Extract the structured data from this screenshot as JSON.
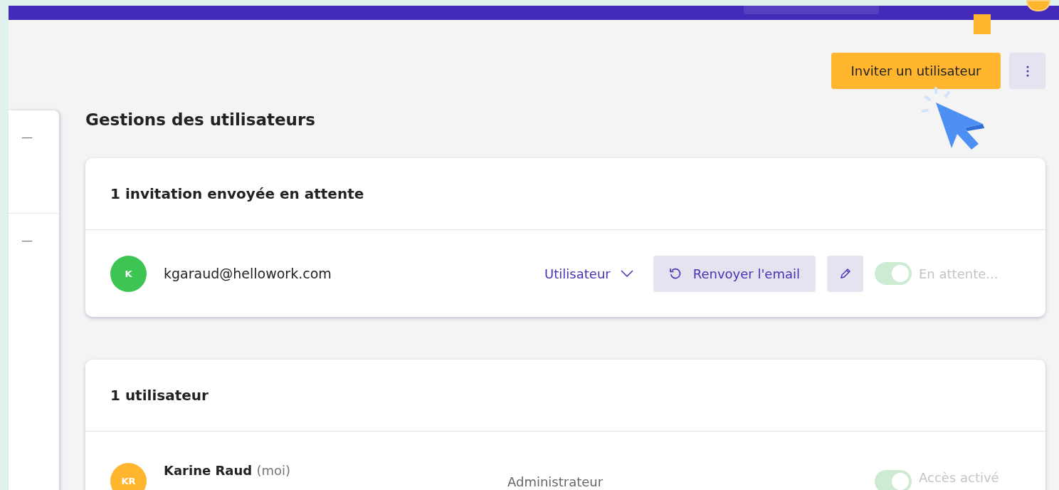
{
  "header": {
    "invite_button": "Inviter un utilisateur"
  },
  "page_title": "Gestions des utilisateurs",
  "sidebar": {
    "items": [
      {
        "label": "—"
      },
      {
        "label": "—"
      }
    ]
  },
  "sections": [
    {
      "title": "1 invitation envoyée en attente",
      "rows": [
        {
          "kind": "invite",
          "initials": "K",
          "color": "#3cc552",
          "name": "kgaraud@hellowork.com",
          "role": "Utilisateur",
          "resend_label": "Renvoyer l'email",
          "toggle_on": true,
          "status": "En attente..."
        }
      ]
    },
    {
      "title": "1 utilisateur",
      "rows": [
        {
          "kind": "user",
          "initials": "KR",
          "color": "#ffb52e",
          "name": "Karine Raud",
          "suffix": "(moi)",
          "role": "Administrateur",
          "toggle_on": true,
          "status": "Accès activé"
        }
      ]
    }
  ]
}
